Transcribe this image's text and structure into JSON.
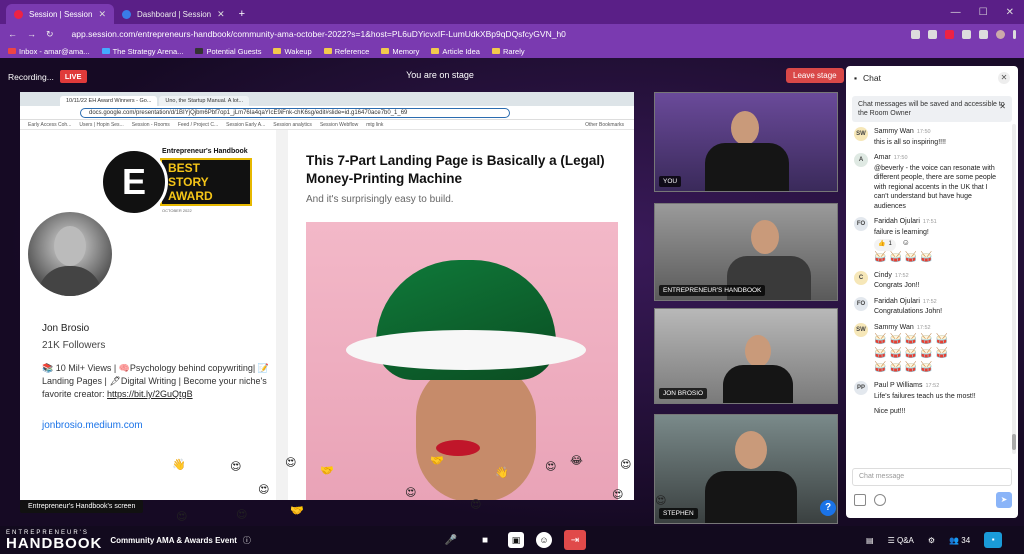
{
  "browser": {
    "tabs": [
      {
        "label": "Session | Session",
        "active": true
      },
      {
        "label": "Dashboard | Session",
        "active": false
      }
    ],
    "url": "app.session.com/entrepreneurs-handbook/community-ama-october-2022?s=1&host=PL6uDYicvxIF-LumUdkXBp9qDQsfcyGVN_h0",
    "bookmarks": [
      "Inbox - amar@ama...",
      "The Strategy Arena...",
      "Potential Guests",
      "Wakeup",
      "Reference",
      "Memory",
      "Article Idea",
      "Rarely"
    ]
  },
  "stage": {
    "recording_label": "Recording...",
    "live_badge": "LIVE",
    "status": "You are on stage",
    "leave_button": "Leave stage",
    "screen_label": "Entrepreneur's Handbook's screen"
  },
  "shared_screen": {
    "tabs": [
      "10/11/22 EH Award Winners - Go...",
      "Uno, the Startup Manual. A lot..."
    ],
    "address": "docs.google.com/presentation/d/1BIYjQjbm6Pbf7op1_jLm76Ia4qaYIcE9iFnk-chK6sg/edit#slide=id.g16470ace7b0_1_69",
    "bookmarks": [
      "Early Access Coh...",
      "Users | Hopin Ses...",
      "Session - Rooms",
      "Feed / Project C...",
      "Session Early A...",
      "Session analytics",
      "Session Webflow",
      "mtg link",
      "Other Bookmarks"
    ],
    "award": {
      "header": "Entrepreneur's Handbook",
      "title_lines": [
        "BEST",
        "STORY",
        "AWARD"
      ],
      "date": "OCTOBER 2022",
      "logo_letter": "E"
    },
    "author": {
      "name": "Jon Brosio",
      "followers": "21K Followers",
      "bio": "📚 10 Mil+ Views | 🧠Psychology behind copywriting| 📝Landing Pages | 🖋Digital Writing | Become your niche's favorite creator: ",
      "bio_link": "https://bit.ly/2GuQtgB",
      "site": "jonbrosio.medium.com"
    },
    "article": {
      "headline": "This 7-Part Landing Page is Basically a (Legal) Money-Printing Machine",
      "subtitle": "And it's surprisingly easy to build."
    }
  },
  "tiles": [
    {
      "label": "YOU"
    },
    {
      "label": "ENTREPRENEUR'S HANDBOOK"
    },
    {
      "label": "JON BROSIO"
    },
    {
      "label": "STEPHEN"
    }
  ],
  "chat": {
    "title": "Chat",
    "notice": "Chat messages will be saved and accessible to the Room Owner",
    "messages": [
      {
        "initials": "SW",
        "name": "Sammy Wan",
        "time": "17:50",
        "text": "this is all so inspiring!!!!",
        "color": "#f6e7b8"
      },
      {
        "initials": "A",
        "name": "Amar",
        "time": "17:50",
        "text": "@beverly - the voice can resonate with different people, there are some people with regional accents in the UK that I can't understand but have huge audiences",
        "color": "#dfe9e3"
      },
      {
        "initials": "FO",
        "name": "Faridah Ojulari",
        "time": "17:51",
        "text": "failure is learning!",
        "color": "#e3e8ee"
      },
      {
        "initials": "C",
        "name": "Cindy",
        "time": "17:52",
        "text": "Congrats Jon!!",
        "color": "#f6e7b8"
      },
      {
        "initials": "FO",
        "name": "Faridah Ojulari",
        "time": "17:52",
        "text": "Congratulations John!",
        "color": "#e3e8ee"
      },
      {
        "initials": "SW",
        "name": "Sammy Wan",
        "time": "17:52",
        "text": "",
        "color": "#f6e7b8"
      },
      {
        "initials": "PP",
        "name": "Paul P Williams",
        "time": "17:52",
        "text": "Life's failures teach us the most!!",
        "color": "#e3e8ee"
      }
    ],
    "followup": "Nice put!!!",
    "reaction_count": "1",
    "input_placeholder": "Chat message"
  },
  "bottom": {
    "brand_small": "ENTREPRENEUR'S",
    "brand_big": "HANDBOOK",
    "event_title": "Community AMA & Awards Event",
    "qa_label": "Q&A",
    "participants": "34"
  }
}
